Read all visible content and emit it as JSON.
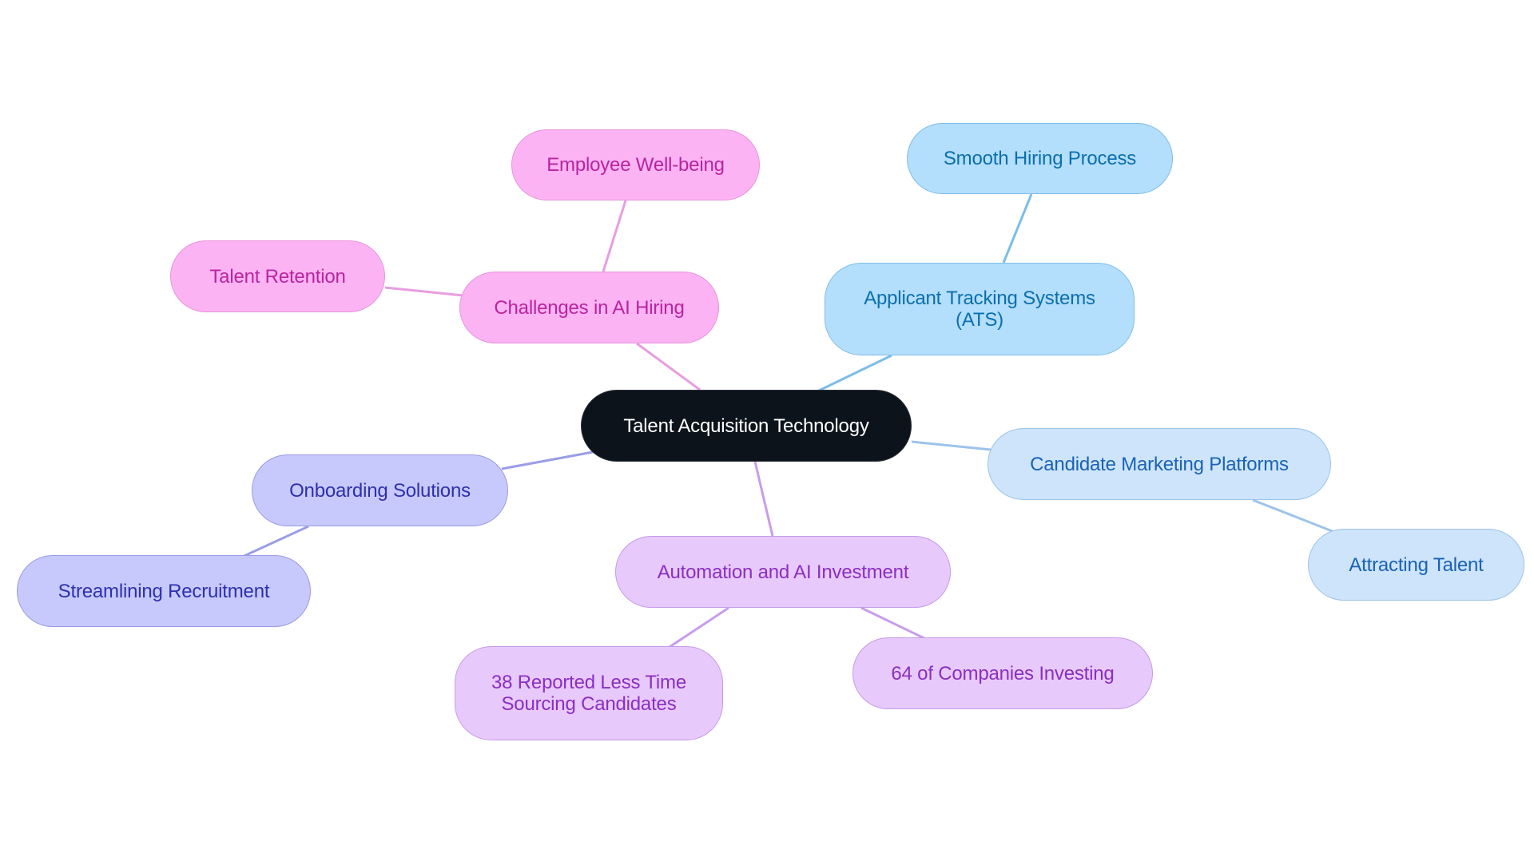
{
  "diagram": {
    "type": "mindmap",
    "root": {
      "id": "root",
      "label": "Talent Acquisition Technology"
    },
    "nodes": [
      {
        "id": "chal",
        "label": "Challenges in AI Hiring",
        "parent": "root",
        "color": "pink"
      },
      {
        "id": "well",
        "label": "Employee Well-being",
        "parent": "chal",
        "color": "pink"
      },
      {
        "id": "ret",
        "label": "Talent Retention",
        "parent": "chal",
        "color": "pink"
      },
      {
        "id": "ats",
        "label": "Applicant Tracking Systems\n(ATS)",
        "parent": "root",
        "color": "sky"
      },
      {
        "id": "smooth",
        "label": "Smooth Hiring Process",
        "parent": "ats",
        "color": "sky"
      },
      {
        "id": "cand",
        "label": "Candidate Marketing Platforms",
        "parent": "root",
        "color": "pale"
      },
      {
        "id": "attr",
        "label": "Attracting Talent",
        "parent": "cand",
        "color": "pale"
      },
      {
        "id": "onb",
        "label": "Onboarding Solutions",
        "parent": "root",
        "color": "lav"
      },
      {
        "id": "stream",
        "label": "Streamlining Recruitment",
        "parent": "onb",
        "color": "lav"
      },
      {
        "id": "auto",
        "label": "Automation and AI Investment",
        "parent": "root",
        "color": "purp"
      },
      {
        "id": "n38",
        "label": "38 Reported Less Time\nSourcing Candidates",
        "parent": "auto",
        "color": "purp"
      },
      {
        "id": "n64",
        "label": "64 of Companies Investing",
        "parent": "auto",
        "color": "purp"
      }
    ],
    "edge_colors": {
      "pink": "#e79ee0",
      "sky": "#7cbde8",
      "pale": "#9cc3ea",
      "lav": "#9a9de6",
      "purp": "#c89ceb"
    }
  }
}
